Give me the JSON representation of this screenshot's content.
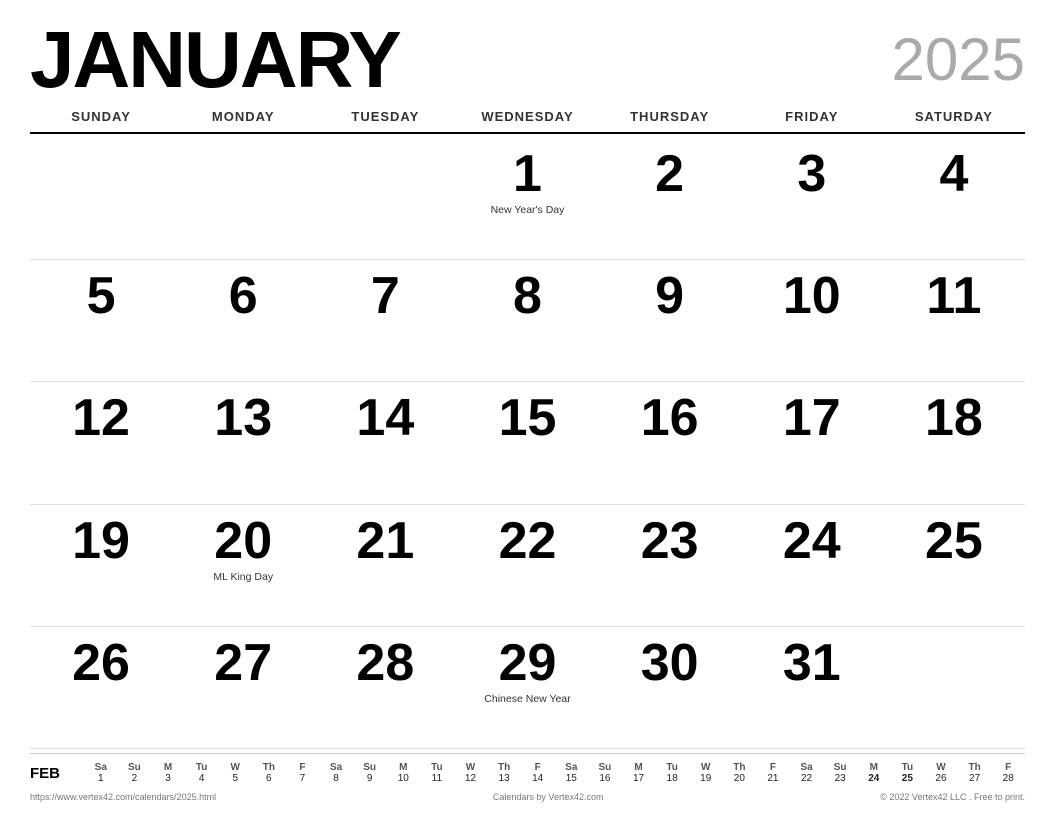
{
  "header": {
    "month": "JANUARY",
    "year": "2025"
  },
  "day_headers": [
    "SUNDAY",
    "MONDAY",
    "TUESDAY",
    "WEDNESDAY",
    "THURSDAY",
    "FRIDAY",
    "SATURDAY"
  ],
  "weeks": [
    [
      {
        "day": "",
        "holiday": ""
      },
      {
        "day": "",
        "holiday": ""
      },
      {
        "day": "",
        "holiday": ""
      },
      {
        "day": "1",
        "holiday": "New Year's Day"
      },
      {
        "day": "2",
        "holiday": ""
      },
      {
        "day": "3",
        "holiday": ""
      },
      {
        "day": "4",
        "holiday": ""
      }
    ],
    [
      {
        "day": "5",
        "holiday": ""
      },
      {
        "day": "6",
        "holiday": ""
      },
      {
        "day": "7",
        "holiday": ""
      },
      {
        "day": "8",
        "holiday": ""
      },
      {
        "day": "9",
        "holiday": ""
      },
      {
        "day": "10",
        "holiday": ""
      },
      {
        "day": "11",
        "holiday": ""
      }
    ],
    [
      {
        "day": "12",
        "holiday": ""
      },
      {
        "day": "13",
        "holiday": ""
      },
      {
        "day": "14",
        "holiday": ""
      },
      {
        "day": "15",
        "holiday": ""
      },
      {
        "day": "16",
        "holiday": ""
      },
      {
        "day": "17",
        "holiday": ""
      },
      {
        "day": "18",
        "holiday": ""
      }
    ],
    [
      {
        "day": "19",
        "holiday": ""
      },
      {
        "day": "20",
        "holiday": "ML King Day"
      },
      {
        "day": "21",
        "holiday": ""
      },
      {
        "day": "22",
        "holiday": ""
      },
      {
        "day": "23",
        "holiday": ""
      },
      {
        "day": "24",
        "holiday": ""
      },
      {
        "day": "25",
        "holiday": ""
      }
    ],
    [
      {
        "day": "26",
        "holiday": ""
      },
      {
        "day": "27",
        "holiday": ""
      },
      {
        "day": "28",
        "holiday": ""
      },
      {
        "day": "29",
        "holiday": "Chinese New Year"
      },
      {
        "day": "30",
        "holiday": ""
      },
      {
        "day": "31",
        "holiday": ""
      },
      {
        "day": "",
        "holiday": ""
      }
    ]
  ],
  "mini_calendar": {
    "month_label": "FEB",
    "headers": [
      "Sa",
      "Su",
      "M",
      "Tu",
      "W",
      "Th",
      "F",
      "Sa",
      "Su",
      "M",
      "Tu",
      "W",
      "Th",
      "F",
      "Sa",
      "Su",
      "M",
      "Tu",
      "W",
      "Th",
      "F",
      "Sa",
      "Su",
      "M",
      "Tu",
      "W",
      "Th",
      "F"
    ],
    "days": [
      "1",
      "2",
      "3",
      "4",
      "5",
      "6",
      "7",
      "8",
      "9",
      "10",
      "11",
      "12",
      "13",
      "14",
      "15",
      "16",
      "17",
      "18",
      "19",
      "20",
      "21",
      "22",
      "23",
      "24",
      "25",
      "26",
      "27",
      "28"
    ],
    "bold_days": [
      "24",
      "25"
    ]
  },
  "footer": {
    "url": "https://www.vertex42.com/calendars/2025.html",
    "center": "Calendars by Vertex42.com",
    "right": "© 2022 Vertex42 LLC . Free to print."
  }
}
